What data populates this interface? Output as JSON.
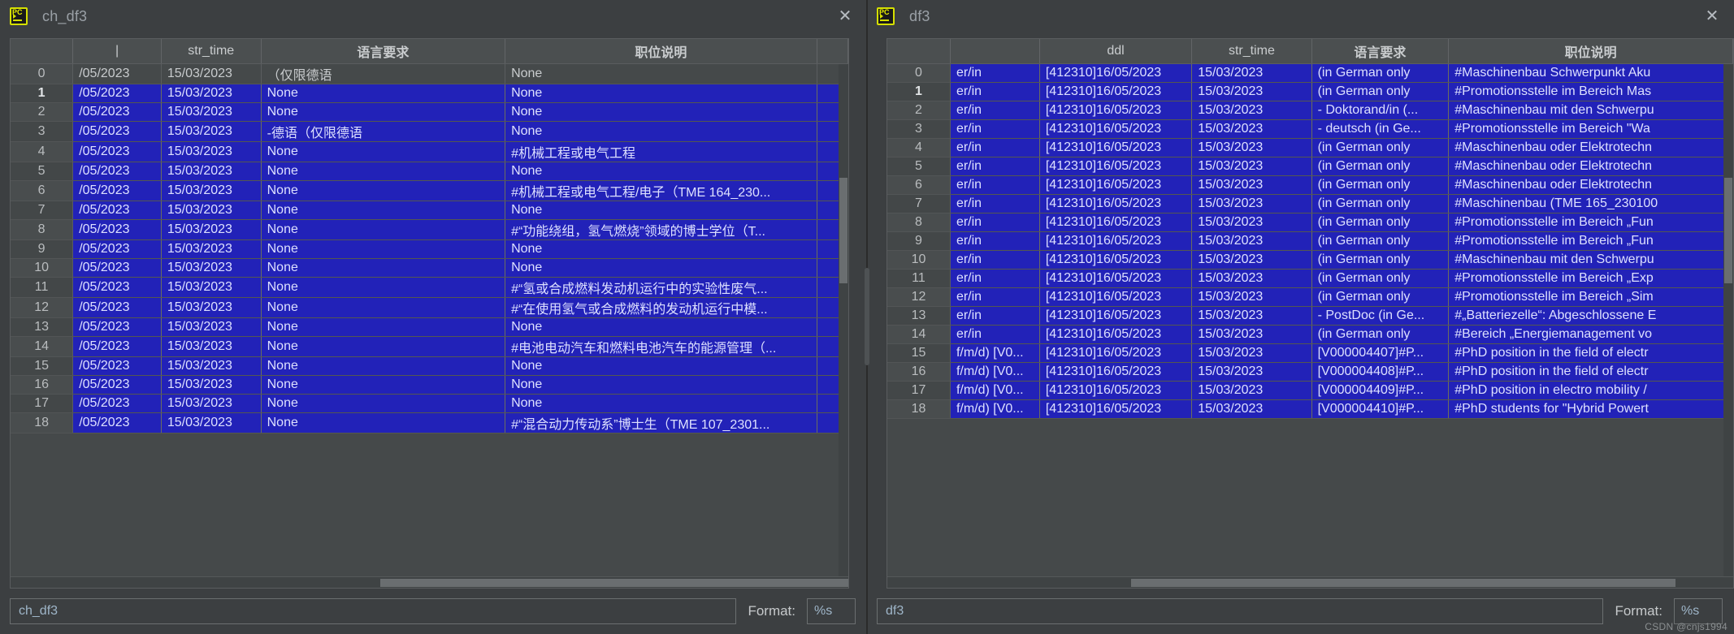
{
  "left_window": {
    "title": "ch_df3",
    "icon": "pycharm-icon",
    "close_label": "✕",
    "columns": [
      "",
      "",
      "str_time",
      "语言要求",
      "职位说明"
    ],
    "header_index": "",
    "header_partial": "|",
    "rows": [
      {
        "idx": "0",
        "c1": "/05/2023",
        "str_time": "15/03/2023",
        "lang": "（仅限德语",
        "desc": "None",
        "selected": false
      },
      {
        "idx": "1",
        "c1": "/05/2023",
        "str_time": "15/03/2023",
        "lang": "None",
        "desc": "None",
        "selected": true
      },
      {
        "idx": "2",
        "c1": "/05/2023",
        "str_time": "15/03/2023",
        "lang": "None",
        "desc": "None",
        "selected": true
      },
      {
        "idx": "3",
        "c1": "/05/2023",
        "str_time": "15/03/2023",
        "lang": "-德语（仅限德语",
        "desc": "None",
        "selected": true
      },
      {
        "idx": "4",
        "c1": "/05/2023",
        "str_time": "15/03/2023",
        "lang": "None",
        "desc": "#机械工程或电气工程",
        "selected": true
      },
      {
        "idx": "5",
        "c1": "/05/2023",
        "str_time": "15/03/2023",
        "lang": "None",
        "desc": "None",
        "selected": true
      },
      {
        "idx": "6",
        "c1": "/05/2023",
        "str_time": "15/03/2023",
        "lang": "None",
        "desc": "#机械工程或电气工程/电子（TME 164_230...",
        "selected": true
      },
      {
        "idx": "7",
        "c1": "/05/2023",
        "str_time": "15/03/2023",
        "lang": "None",
        "desc": "None",
        "selected": true
      },
      {
        "idx": "8",
        "c1": "/05/2023",
        "str_time": "15/03/2023",
        "lang": "None",
        "desc": "#“功能绕组，氢气燃烧”领域的博士学位（T...",
        "selected": true
      },
      {
        "idx": "9",
        "c1": "/05/2023",
        "str_time": "15/03/2023",
        "lang": "None",
        "desc": "None",
        "selected": true
      },
      {
        "idx": "10",
        "c1": "/05/2023",
        "str_time": "15/03/2023",
        "lang": "None",
        "desc": "None",
        "selected": true
      },
      {
        "idx": "11",
        "c1": "/05/2023",
        "str_time": "15/03/2023",
        "lang": "None",
        "desc": "#“氢或合成燃料发动机运行中的实验性废气...",
        "selected": true
      },
      {
        "idx": "12",
        "c1": "/05/2023",
        "str_time": "15/03/2023",
        "lang": "None",
        "desc": "#“在使用氢气或合成燃料的发动机运行中模...",
        "selected": true
      },
      {
        "idx": "13",
        "c1": "/05/2023",
        "str_time": "15/03/2023",
        "lang": "None",
        "desc": "None",
        "selected": true
      },
      {
        "idx": "14",
        "c1": "/05/2023",
        "str_time": "15/03/2023",
        "lang": "None",
        "desc": "#电池电动汽车和燃料电池汽车的能源管理（...",
        "selected": true
      },
      {
        "idx": "15",
        "c1": "/05/2023",
        "str_time": "15/03/2023",
        "lang": "None",
        "desc": "None",
        "selected": true
      },
      {
        "idx": "16",
        "c1": "/05/2023",
        "str_time": "15/03/2023",
        "lang": "None",
        "desc": "None",
        "selected": true
      },
      {
        "idx": "17",
        "c1": "/05/2023",
        "str_time": "15/03/2023",
        "lang": "None",
        "desc": "None",
        "selected": true
      },
      {
        "idx": "18",
        "c1": "/05/2023",
        "str_time": "15/03/2023",
        "lang": "None",
        "desc": "#“混合动力传动系”博士生（TME 107_2301...",
        "selected": true
      }
    ],
    "name_value": "ch_df3",
    "format_label": "Format:",
    "format_value": "%s"
  },
  "right_window": {
    "title": "df3",
    "icon": "pycharm-icon",
    "close_label": "✕",
    "columns": [
      "",
      "",
      "ddl",
      "str_time",
      "语言要求",
      "职位说明"
    ],
    "rows": [
      {
        "idx": "0",
        "c1": "er/in",
        "ddl": "[412310]16/05/2023",
        "str_time": "15/03/2023",
        "lang": "(in German only",
        "desc": "#Maschinenbau Schwerpunkt Aku",
        "selected": true
      },
      {
        "idx": "1",
        "c1": "er/in",
        "ddl": "[412310]16/05/2023",
        "str_time": "15/03/2023",
        "lang": "(in German only",
        "desc": "#Promotionsstelle im Bereich Mas",
        "selected": true
      },
      {
        "idx": "2",
        "c1": "er/in",
        "ddl": "[412310]16/05/2023",
        "str_time": "15/03/2023",
        "lang": "- Doktorand/in (...",
        "desc": "#Maschinenbau mit den Schwerpu",
        "selected": true
      },
      {
        "idx": "3",
        "c1": "er/in",
        "ddl": "[412310]16/05/2023",
        "str_time": "15/03/2023",
        "lang": "- deutsch (in Ge...",
        "desc": "#Promotionsstelle im Bereich \"Wa",
        "selected": true
      },
      {
        "idx": "4",
        "c1": "er/in",
        "ddl": "[412310]16/05/2023",
        "str_time": "15/03/2023",
        "lang": "(in German only",
        "desc": "#Maschinenbau oder Elektrotechn",
        "selected": true
      },
      {
        "idx": "5",
        "c1": "er/in",
        "ddl": "[412310]16/05/2023",
        "str_time": "15/03/2023",
        "lang": "(in German only",
        "desc": "#Maschinenbau oder Elektrotechn",
        "selected": true
      },
      {
        "idx": "6",
        "c1": "er/in",
        "ddl": "[412310]16/05/2023",
        "str_time": "15/03/2023",
        "lang": "(in German only",
        "desc": "#Maschinenbau oder Elektrotechn",
        "selected": true
      },
      {
        "idx": "7",
        "c1": "er/in",
        "ddl": "[412310]16/05/2023",
        "str_time": "15/03/2023",
        "lang": "(in German only",
        "desc": "#Maschinenbau (TME 165_230100",
        "selected": true
      },
      {
        "idx": "8",
        "c1": "er/in",
        "ddl": "[412310]16/05/2023",
        "str_time": "15/03/2023",
        "lang": "(in German only",
        "desc": "#Promotionsstelle im Bereich „Fun",
        "selected": true
      },
      {
        "idx": "9",
        "c1": "er/in",
        "ddl": "[412310]16/05/2023",
        "str_time": "15/03/2023",
        "lang": "(in German only",
        "desc": "#Promotionsstelle im Bereich „Fun",
        "selected": true
      },
      {
        "idx": "10",
        "c1": "er/in",
        "ddl": "[412310]16/05/2023",
        "str_time": "15/03/2023",
        "lang": "(in German only",
        "desc": "#Maschinenbau mit den Schwerpu",
        "selected": true
      },
      {
        "idx": "11",
        "c1": "er/in",
        "ddl": "[412310]16/05/2023",
        "str_time": "15/03/2023",
        "lang": "(in German only",
        "desc": "#Promotionsstelle im Bereich „Exp",
        "selected": true
      },
      {
        "idx": "12",
        "c1": "er/in",
        "ddl": "[412310]16/05/2023",
        "str_time": "15/03/2023",
        "lang": "(in German only",
        "desc": "#Promotionsstelle im Bereich „Sim",
        "selected": true
      },
      {
        "idx": "13",
        "c1": "er/in",
        "ddl": "[412310]16/05/2023",
        "str_time": "15/03/2023",
        "lang": "- PostDoc (in Ge...",
        "desc": "#„Batteriezelle“: Abgeschlossene E",
        "selected": true
      },
      {
        "idx": "14",
        "c1": "er/in",
        "ddl": "[412310]16/05/2023",
        "str_time": "15/03/2023",
        "lang": "(in German only",
        "desc": "#Bereich „Energiemanagement vo",
        "selected": true
      },
      {
        "idx": "15",
        "c1": "f/m/d) [V0...",
        "ddl": "[412310]16/05/2023",
        "str_time": "15/03/2023",
        "lang": "[V000004407]#P...",
        "desc": "#PhD position in the field of electr",
        "selected": true
      },
      {
        "idx": "16",
        "c1": "f/m/d) [V0...",
        "ddl": "[412310]16/05/2023",
        "str_time": "15/03/2023",
        "lang": "[V000004408]#P...",
        "desc": "#PhD position in the field of electr",
        "selected": true
      },
      {
        "idx": "17",
        "c1": "f/m/d) [V0...",
        "ddl": "[412310]16/05/2023",
        "str_time": "15/03/2023",
        "lang": "[V000004409]#P...",
        "desc": "#PhD position in electro mobility /",
        "selected": true
      },
      {
        "idx": "18",
        "c1": "f/m/d) [V0...",
        "ddl": "[412310]16/05/2023",
        "str_time": "15/03/2023",
        "lang": "[V000004410]#P...",
        "desc": "#PhD students for \"Hybrid Powert",
        "selected": true
      }
    ],
    "name_value": "df3",
    "format_label": "Format:",
    "format_value": "%s"
  },
  "watermark": "CSDN @cnjs1994",
  "colors": {
    "selection": "#2222b8",
    "window_bg": "#3c3f41",
    "grid_bg": "#45494a",
    "header_bg": "#4b4f50",
    "text": "#c8cbcd"
  }
}
